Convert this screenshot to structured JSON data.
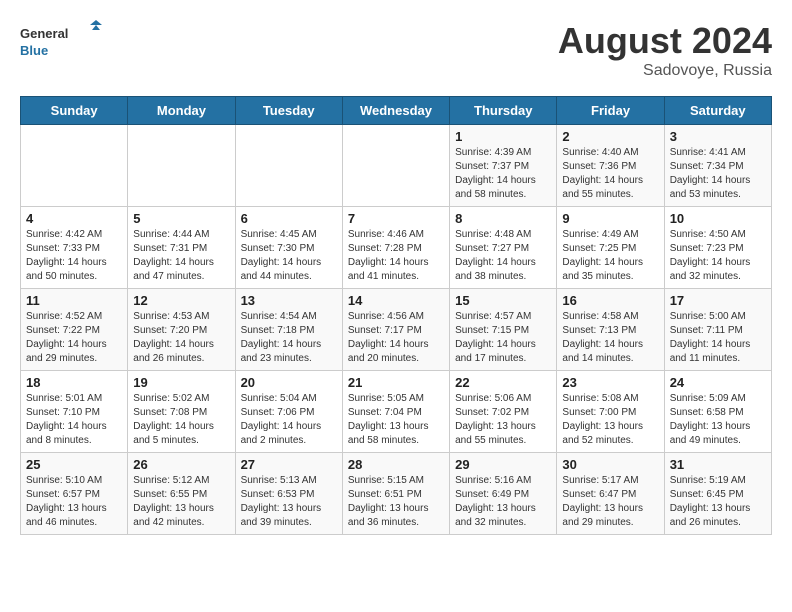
{
  "header": {
    "logo_line1": "General",
    "logo_line2": "Blue",
    "month_year": "August 2024",
    "location": "Sadovoye, Russia"
  },
  "days_of_week": [
    "Sunday",
    "Monday",
    "Tuesday",
    "Wednesday",
    "Thursday",
    "Friday",
    "Saturday"
  ],
  "weeks": [
    [
      {
        "day": "",
        "info": ""
      },
      {
        "day": "",
        "info": ""
      },
      {
        "day": "",
        "info": ""
      },
      {
        "day": "",
        "info": ""
      },
      {
        "day": "1",
        "info": "Sunrise: 4:39 AM\nSunset: 7:37 PM\nDaylight: 14 hours\nand 58 minutes."
      },
      {
        "day": "2",
        "info": "Sunrise: 4:40 AM\nSunset: 7:36 PM\nDaylight: 14 hours\nand 55 minutes."
      },
      {
        "day": "3",
        "info": "Sunrise: 4:41 AM\nSunset: 7:34 PM\nDaylight: 14 hours\nand 53 minutes."
      }
    ],
    [
      {
        "day": "4",
        "info": "Sunrise: 4:42 AM\nSunset: 7:33 PM\nDaylight: 14 hours\nand 50 minutes."
      },
      {
        "day": "5",
        "info": "Sunrise: 4:44 AM\nSunset: 7:31 PM\nDaylight: 14 hours\nand 47 minutes."
      },
      {
        "day": "6",
        "info": "Sunrise: 4:45 AM\nSunset: 7:30 PM\nDaylight: 14 hours\nand 44 minutes."
      },
      {
        "day": "7",
        "info": "Sunrise: 4:46 AM\nSunset: 7:28 PM\nDaylight: 14 hours\nand 41 minutes."
      },
      {
        "day": "8",
        "info": "Sunrise: 4:48 AM\nSunset: 7:27 PM\nDaylight: 14 hours\nand 38 minutes."
      },
      {
        "day": "9",
        "info": "Sunrise: 4:49 AM\nSunset: 7:25 PM\nDaylight: 14 hours\nand 35 minutes."
      },
      {
        "day": "10",
        "info": "Sunrise: 4:50 AM\nSunset: 7:23 PM\nDaylight: 14 hours\nand 32 minutes."
      }
    ],
    [
      {
        "day": "11",
        "info": "Sunrise: 4:52 AM\nSunset: 7:22 PM\nDaylight: 14 hours\nand 29 minutes."
      },
      {
        "day": "12",
        "info": "Sunrise: 4:53 AM\nSunset: 7:20 PM\nDaylight: 14 hours\nand 26 minutes."
      },
      {
        "day": "13",
        "info": "Sunrise: 4:54 AM\nSunset: 7:18 PM\nDaylight: 14 hours\nand 23 minutes."
      },
      {
        "day": "14",
        "info": "Sunrise: 4:56 AM\nSunset: 7:17 PM\nDaylight: 14 hours\nand 20 minutes."
      },
      {
        "day": "15",
        "info": "Sunrise: 4:57 AM\nSunset: 7:15 PM\nDaylight: 14 hours\nand 17 minutes."
      },
      {
        "day": "16",
        "info": "Sunrise: 4:58 AM\nSunset: 7:13 PM\nDaylight: 14 hours\nand 14 minutes."
      },
      {
        "day": "17",
        "info": "Sunrise: 5:00 AM\nSunset: 7:11 PM\nDaylight: 14 hours\nand 11 minutes."
      }
    ],
    [
      {
        "day": "18",
        "info": "Sunrise: 5:01 AM\nSunset: 7:10 PM\nDaylight: 14 hours\nand 8 minutes."
      },
      {
        "day": "19",
        "info": "Sunrise: 5:02 AM\nSunset: 7:08 PM\nDaylight: 14 hours\nand 5 minutes."
      },
      {
        "day": "20",
        "info": "Sunrise: 5:04 AM\nSunset: 7:06 PM\nDaylight: 14 hours\nand 2 minutes."
      },
      {
        "day": "21",
        "info": "Sunrise: 5:05 AM\nSunset: 7:04 PM\nDaylight: 13 hours\nand 58 minutes."
      },
      {
        "day": "22",
        "info": "Sunrise: 5:06 AM\nSunset: 7:02 PM\nDaylight: 13 hours\nand 55 minutes."
      },
      {
        "day": "23",
        "info": "Sunrise: 5:08 AM\nSunset: 7:00 PM\nDaylight: 13 hours\nand 52 minutes."
      },
      {
        "day": "24",
        "info": "Sunrise: 5:09 AM\nSunset: 6:58 PM\nDaylight: 13 hours\nand 49 minutes."
      }
    ],
    [
      {
        "day": "25",
        "info": "Sunrise: 5:10 AM\nSunset: 6:57 PM\nDaylight: 13 hours\nand 46 minutes."
      },
      {
        "day": "26",
        "info": "Sunrise: 5:12 AM\nSunset: 6:55 PM\nDaylight: 13 hours\nand 42 minutes."
      },
      {
        "day": "27",
        "info": "Sunrise: 5:13 AM\nSunset: 6:53 PM\nDaylight: 13 hours\nand 39 minutes."
      },
      {
        "day": "28",
        "info": "Sunrise: 5:15 AM\nSunset: 6:51 PM\nDaylight: 13 hours\nand 36 minutes."
      },
      {
        "day": "29",
        "info": "Sunrise: 5:16 AM\nSunset: 6:49 PM\nDaylight: 13 hours\nand 32 minutes."
      },
      {
        "day": "30",
        "info": "Sunrise: 5:17 AM\nSunset: 6:47 PM\nDaylight: 13 hours\nand 29 minutes."
      },
      {
        "day": "31",
        "info": "Sunrise: 5:19 AM\nSunset: 6:45 PM\nDaylight: 13 hours\nand 26 minutes."
      }
    ]
  ]
}
